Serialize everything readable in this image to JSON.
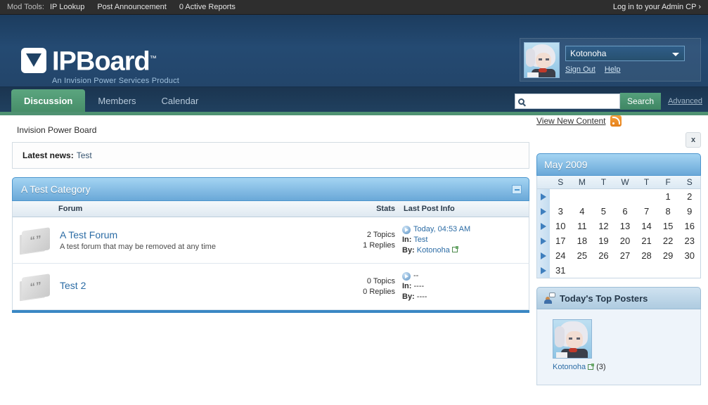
{
  "modbar": {
    "label": "Mod Tools:",
    "links": [
      "IP Lookup",
      "Post Announcement",
      "0 Active Reports"
    ],
    "admin_cp": "Log in to your Admin CP ›"
  },
  "header": {
    "logo_text": "IPBoard",
    "logo_tm": "™",
    "logo_sub": "An Invision Power Services Product",
    "user": {
      "name": "Kotonoha",
      "sign_out": "Sign Out",
      "help": "Help"
    }
  },
  "nav": {
    "tabs": [
      {
        "label": "Discussion",
        "active": true
      },
      {
        "label": "Members",
        "active": false
      },
      {
        "label": "Calendar",
        "active": false
      }
    ],
    "search": {
      "value": "",
      "placeholder": "",
      "button": "Search",
      "advanced": "Advanced"
    }
  },
  "crumb": {
    "breadcrumb": "Invision Power Board",
    "view_new_content": "View New Content"
  },
  "news": {
    "label": "Latest news:",
    "text": "Test"
  },
  "category": {
    "title": "A Test Category",
    "columns": {
      "forum": "Forum",
      "stats": "Stats",
      "last_post": "Last Post Info"
    },
    "forums": [
      {
        "title": "A Test Forum",
        "desc": "A test forum that may be removed at any time",
        "topics": "2 Topics",
        "replies": "1 Replies",
        "last_date": "Today, 04:53 AM",
        "in_label": "In:",
        "in_value": "Test",
        "by_label": "By:",
        "by_value": "Kotonoha"
      },
      {
        "title": "Test 2",
        "desc": "",
        "topics": "0 Topics",
        "replies": "0 Replies",
        "last_date": "--",
        "in_label": "In:",
        "in_value": "----",
        "by_label": "By:",
        "by_value": "----"
      }
    ]
  },
  "sidebar": {
    "close_label": "x",
    "calendar": {
      "title": "May 2009",
      "dow": [
        "S",
        "M",
        "T",
        "W",
        "T",
        "F",
        "S"
      ],
      "weeks": [
        [
          "",
          "",
          "",
          "",
          "",
          "1",
          "2"
        ],
        [
          "3",
          "4",
          "5",
          "6",
          "7",
          "8",
          "9"
        ],
        [
          "10",
          "11",
          "12",
          "13",
          "14",
          "15",
          "16"
        ],
        [
          "17",
          "18",
          "19",
          "20",
          "21",
          "22",
          "23"
        ],
        [
          "24",
          "25",
          "26",
          "27",
          "28",
          "29",
          "30"
        ],
        [
          "31",
          "",
          "",
          "",
          "",
          "",
          ""
        ]
      ]
    },
    "top_posters": {
      "title": "Today's Top Posters",
      "members": [
        {
          "name": "Kotonoha",
          "count": "(3)"
        }
      ]
    }
  },
  "colors": {
    "accent_green": "#4f9272",
    "accent_blue": "#3a87c4",
    "header_blue": "#23456a",
    "link_blue": "#2c6ca5",
    "rss_orange": "#e4801a"
  }
}
